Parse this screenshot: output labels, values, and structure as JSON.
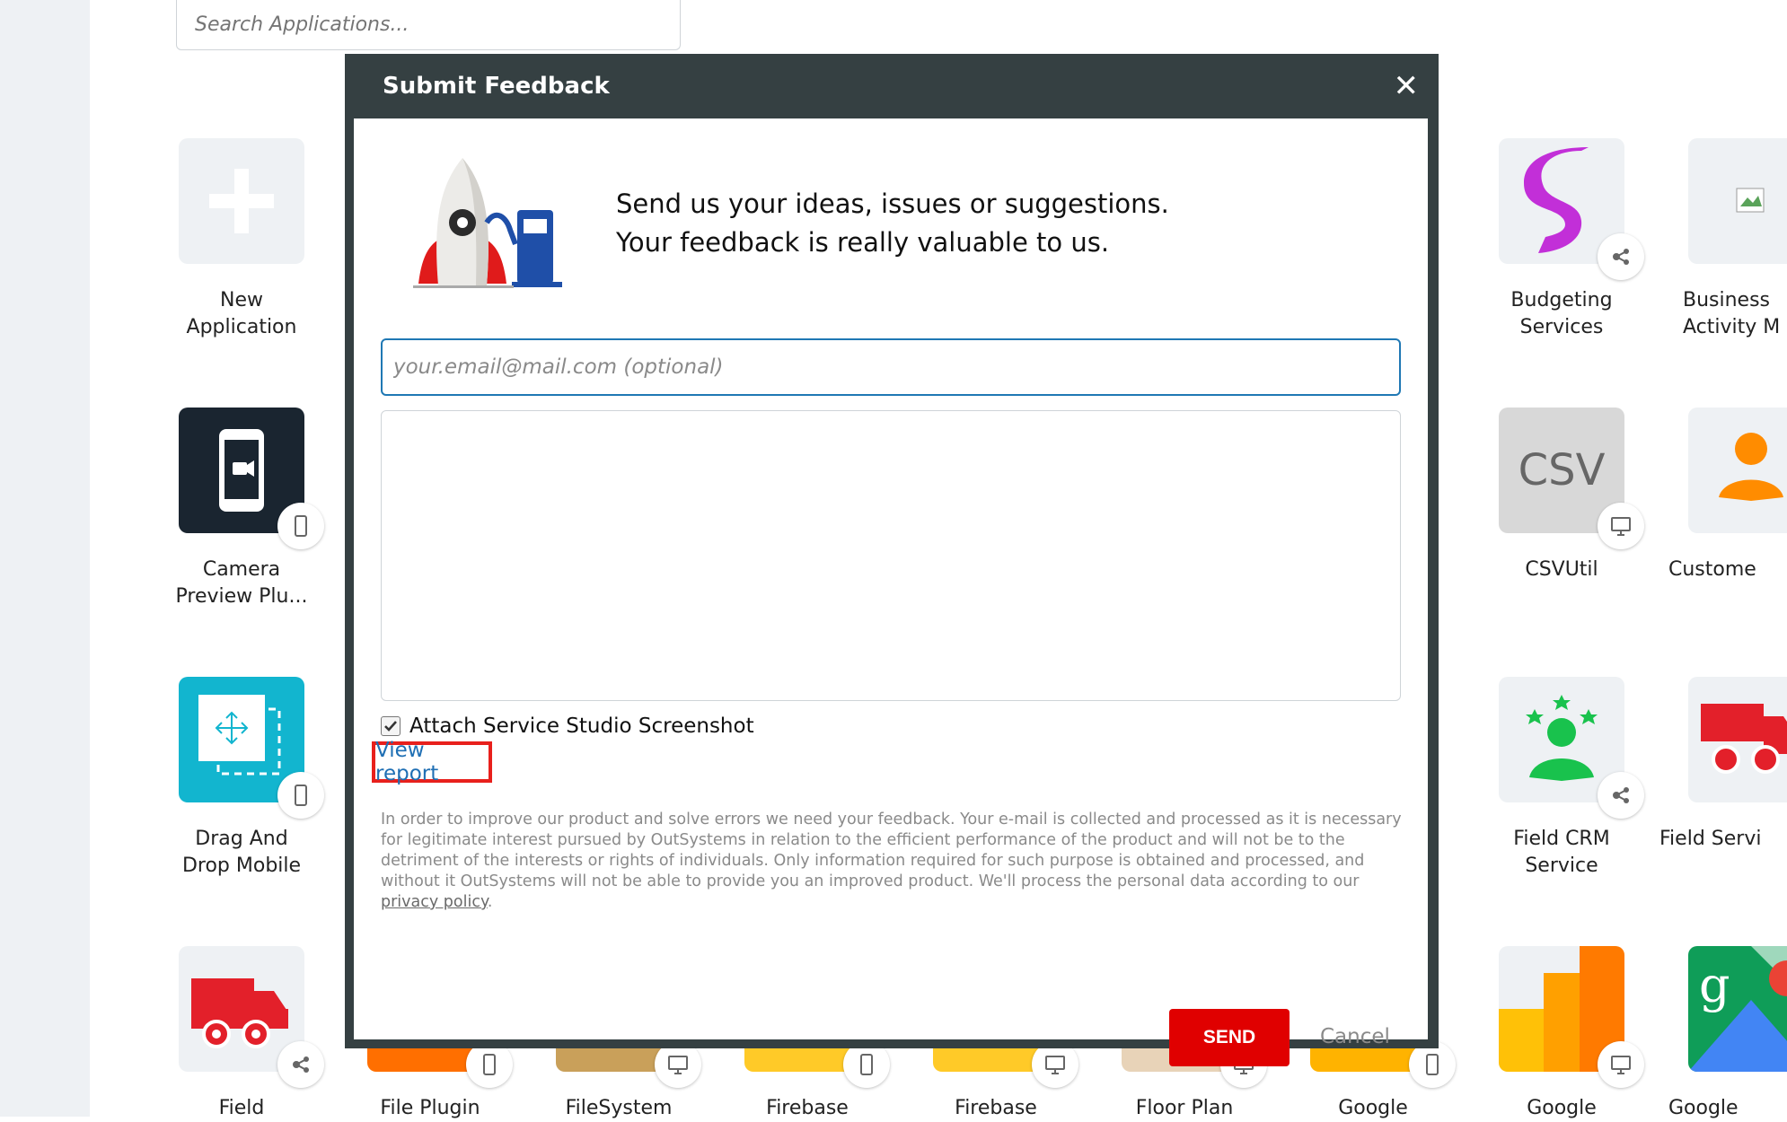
{
  "search": {
    "placeholder": "Search Applications..."
  },
  "apps": {
    "new_application": "New\nApplication",
    "camera_preview": "Camera\nPreview Plu...",
    "drag_and_drop": "Drag And\nDrop Mobile",
    "field_left": "Field",
    "file_plugin": "File Plugin",
    "filesystem": "FileSystem",
    "firebase_1": "Firebase",
    "firebase_2": "Firebase",
    "floor_plan": "Floor Plan",
    "google_1": "Google",
    "google_2": "Google",
    "google_3": "Google",
    "budgeting_services": "Budgeting\nServices",
    "business_activity": "Business\nActivity M",
    "csvutil": "CSVUtil",
    "csv_tile_text": "CSV",
    "customer": "Custome",
    "field_crm": "Field CRM\nService",
    "field_service": "Field Servi"
  },
  "modal": {
    "title": "Submit Feedback",
    "close": "✕",
    "intro_line1": "Send us your ideas, issues or suggestions.",
    "intro_line2": "Your feedback is really valuable to us.",
    "email_placeholder": "your.email@mail.com (optional)",
    "email_value": "",
    "message_value": "",
    "attach_label": "Attach Service Studio Screenshot",
    "attach_checked": true,
    "view_report": "View report",
    "legal_text": "In order to improve our product and solve errors we need your feedback. Your e-mail is collected and processed as it is necessary for legitimate interest pursued by OutSystems in relation to the efficient performance of the product and will not be to the detriment of the interests or rights of individuals. Only information required for such purpose is obtained and processed, and without it OutSystems will not be able to provide you an improved product. We'll process the personal data according to our ",
    "privacy_link": "privacy policy",
    "legal_end": ".",
    "send": "SEND",
    "cancel": "Cancel"
  },
  "colors": {
    "modal_header": "#354042",
    "send_button": "#e00000",
    "highlight_box": "#e8201c",
    "link": "#1f6fb4",
    "email_border": "#1f78b4"
  }
}
